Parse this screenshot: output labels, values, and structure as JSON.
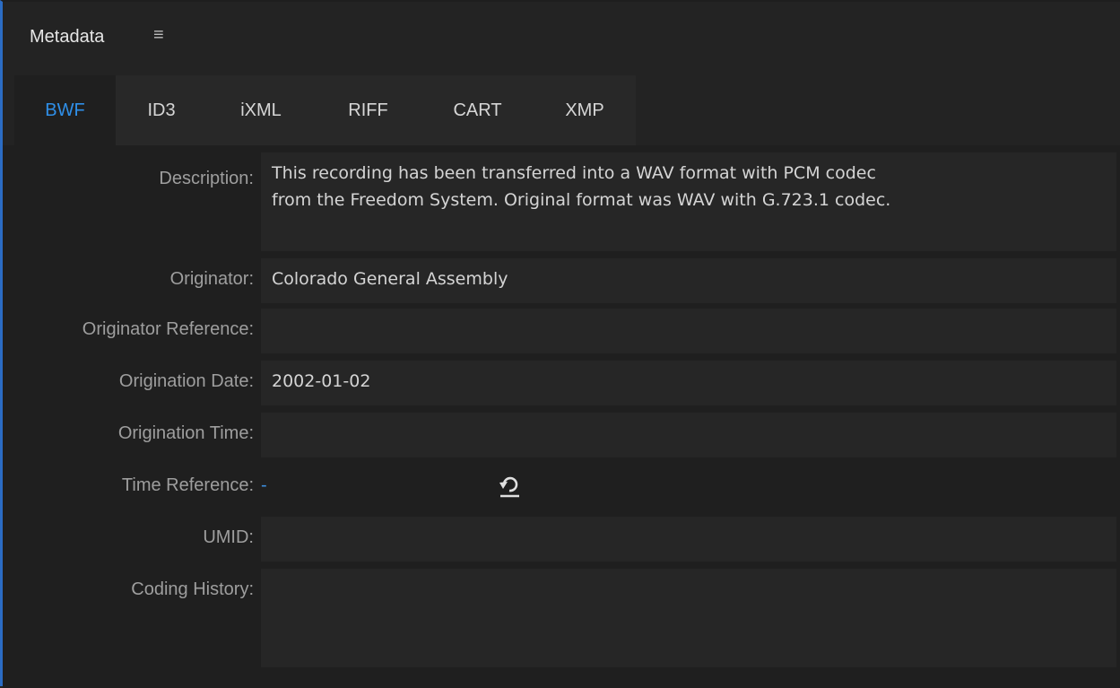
{
  "panel": {
    "title": "Metadata",
    "menu_icon": "hamburger-icon",
    "menu_glyph": "≡",
    "accent": "#2f8fe8"
  },
  "tabs": [
    {
      "label": "BWF",
      "active": true
    },
    {
      "label": "ID3",
      "active": false
    },
    {
      "label": "iXML",
      "active": false
    },
    {
      "label": "RIFF",
      "active": false
    },
    {
      "label": "CART",
      "active": false
    },
    {
      "label": "XMP",
      "active": false
    }
  ],
  "fields": {
    "description": {
      "label": "Description:",
      "value": "This recording has been transferred into a WAV format with PCM codec\nfrom the Freedom System. Original format was WAV with G.723.1 codec."
    },
    "originator": {
      "label": "Originator:",
      "value": "Colorado General Assembly"
    },
    "originator_reference": {
      "label": "Originator Reference:",
      "value": ""
    },
    "origination_date": {
      "label": "Origination Date:",
      "value": "2002-01-02"
    },
    "origination_time": {
      "label": "Origination Time:",
      "value": ""
    },
    "time_reference": {
      "label": "Time Reference:",
      "value": "-",
      "reset_icon": "reset-icon"
    },
    "umid": {
      "label": "UMID:",
      "value": ""
    },
    "coding_history": {
      "label": "Coding History:",
      "value": ""
    }
  }
}
